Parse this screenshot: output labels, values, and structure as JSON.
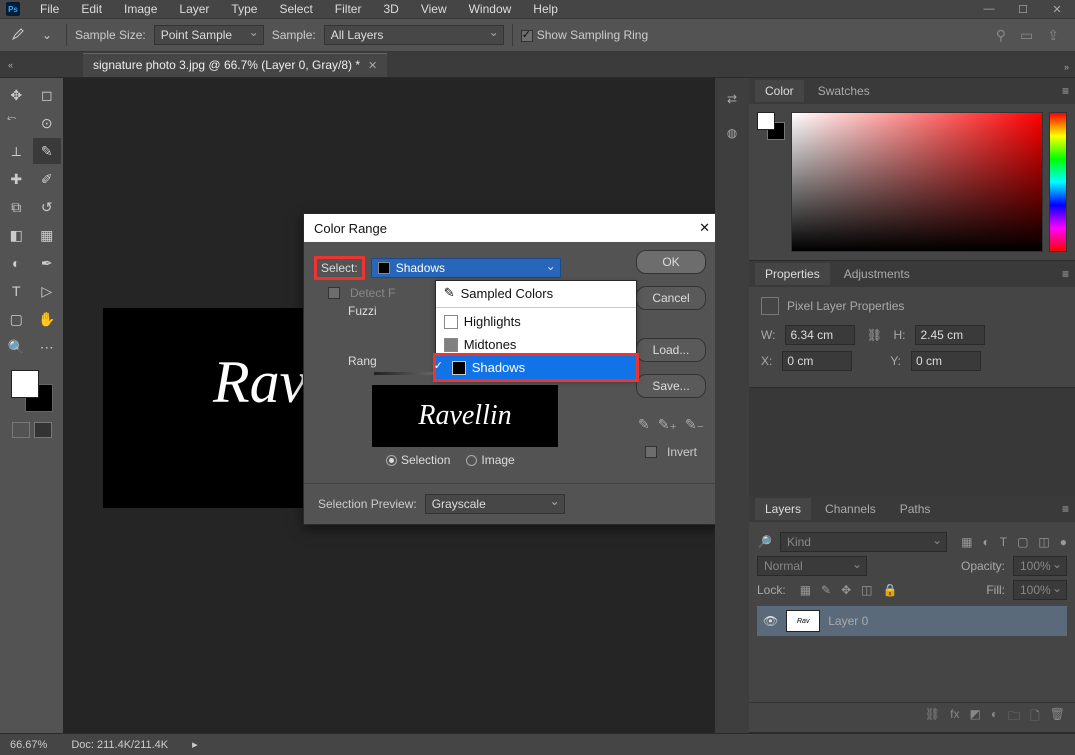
{
  "menu": [
    "File",
    "Edit",
    "Image",
    "Layer",
    "Type",
    "Select",
    "Filter",
    "3D",
    "View",
    "Window",
    "Help"
  ],
  "options": {
    "sample_size_label": "Sample Size:",
    "sample_size_value": "Point Sample",
    "sample_label": "Sample:",
    "sample_value": "All Layers",
    "show_ring": "Show Sampling Ring"
  },
  "document_tab": "signature photo 3.jpg @ 66.7% (Layer 0, Gray/8) *",
  "signature_text": "Ravellin",
  "dialog": {
    "title": "Color Range",
    "select_label": "Select:",
    "select_value": "Shadows",
    "dropdown": {
      "sampled": "Sampled Colors",
      "highlights": "Highlights",
      "midtones": "Midtones",
      "shadows": "Shadows"
    },
    "detect": "Detect F",
    "fuzziness": "Fuzzi",
    "range": "Rang",
    "radios": {
      "selection": "Selection",
      "image": "Image"
    },
    "buttons": {
      "ok": "OK",
      "cancel": "Cancel",
      "load": "Load...",
      "save": "Save..."
    },
    "invert": "Invert",
    "preview_label": "Selection Preview:",
    "preview_value": "Grayscale"
  },
  "right": {
    "color_tab": "Color",
    "swatches_tab": "Swatches",
    "properties_tab": "Properties",
    "adjustments_tab": "Adjustments",
    "pixel_layer": "Pixel Layer Properties",
    "dims": {
      "wlabel": "W:",
      "w": "6.34 cm",
      "hlabel": "H:",
      "h": "2.45 cm",
      "xlabel": "X:",
      "x": "0 cm",
      "ylabel": "Y:",
      "y": "0 cm"
    },
    "layers_tab": "Layers",
    "channels_tab": "Channels",
    "paths_tab": "Paths",
    "kind": "Kind",
    "blend": "Normal",
    "opacity_label": "Opacity:",
    "opacity": "100%",
    "lock": "Lock:",
    "fill_label": "Fill:",
    "fill": "100%",
    "layer_name": "Layer 0"
  },
  "status": {
    "zoom": "66.67%",
    "doc": "Doc: 211.4K/211.4K"
  }
}
